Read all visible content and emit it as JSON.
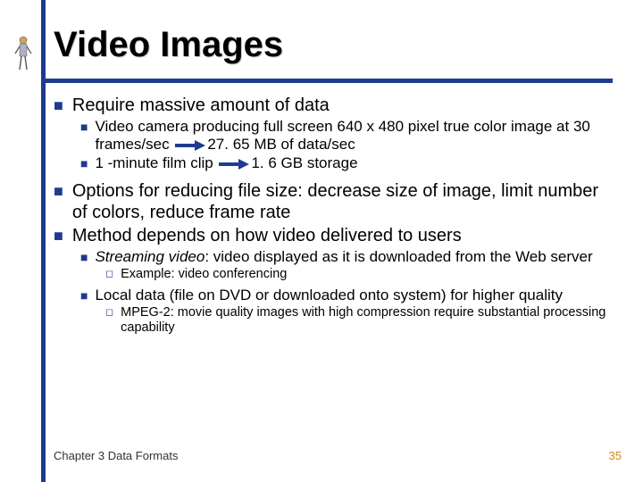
{
  "title": "Video Images",
  "bullets": {
    "l1a": "Require massive amount of data",
    "l2a_part1": "Video camera producing full screen 640 x 480 pixel true color image at 30 frames/sec",
    "l2a_part2": "27. 65 MB of data/sec",
    "l2b_part1": "1 -minute film clip",
    "l2b_part2": "1. 6 GB storage",
    "l1b": "Options for reducing file size: decrease size of image, limit number of colors, reduce frame rate",
    "l1c": "Method depends on how video delivered to users",
    "l2c_italic": "Streaming video",
    "l2c_rest": ": video displayed as it is downloaded from the Web server",
    "l3a": "Example: video conferencing",
    "l2d": "Local data (file on DVD or downloaded onto system) for higher quality",
    "l3b": "MPEG-2: movie quality images with high compression require substantial processing capability"
  },
  "footer": {
    "left": "Chapter 3 Data Formats",
    "right": "35"
  }
}
